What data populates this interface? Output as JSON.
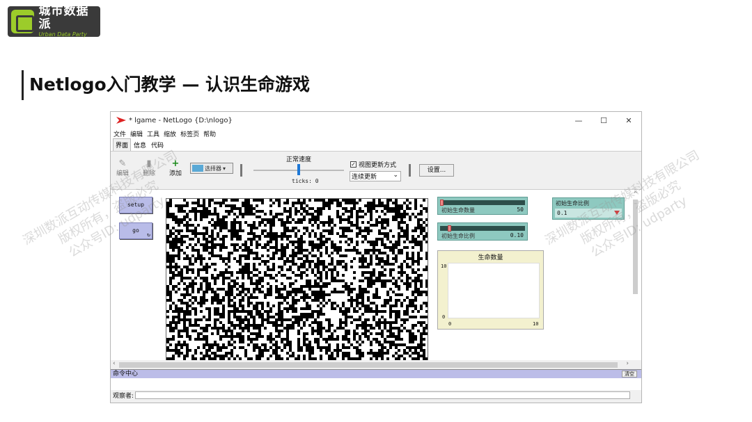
{
  "logo": {
    "main": "城市数据派",
    "sub": "Urban Data Party"
  },
  "slide_title": "Netlogo入门教学 — 认识生命游戏",
  "window": {
    "title": "* lgame - NetLogo {D:\\nlogo}",
    "controls": [
      "—",
      "☐",
      "✕"
    ],
    "menu": [
      "文件",
      "编辑",
      "工具",
      "缩放",
      "标签页",
      "帮助"
    ],
    "tabs": [
      "界面",
      "信息",
      "代码"
    ],
    "toolbar": {
      "edit": "编辑",
      "delete": "删除",
      "add": "添加",
      "select": "选择器",
      "speed_label": "正常速度",
      "ticks": "ticks: 0",
      "view_updates": "视图更新方式",
      "update_mode": "连续更新",
      "settings": "设置..."
    },
    "buttons": {
      "setup": "setup",
      "go": "go"
    },
    "sliders": [
      {
        "name": "初始生命数量",
        "value": "50",
        "fraction": 0.02
      },
      {
        "name": "初始生命比例",
        "value": "0.10",
        "fraction": 0.1
      }
    ],
    "chooser": {
      "name": "初始生命比例",
      "value": "0.1"
    },
    "plot": {
      "title": "生命数量",
      "y_max": "10",
      "y_min": "0",
      "x_min": "0",
      "x_max": "10"
    },
    "command_center": {
      "label": "命令中心",
      "clear": "清空"
    },
    "observer_label": "观察者:"
  },
  "watermark": {
    "line1": "深圳数派互动传媒科技有限公司",
    "line2": "版权所有，盗版必究",
    "line3": "公众号ID: udparty"
  }
}
